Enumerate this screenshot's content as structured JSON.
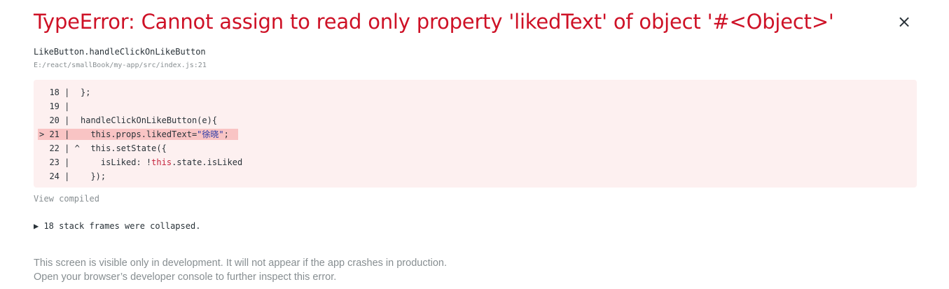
{
  "header": {
    "title": "TypeError: Cannot assign to read only property 'likedText' of object '#<Object>'",
    "close_label": "×"
  },
  "frame": {
    "function": "LikeButton.handleClickOnLikeButton",
    "file": "E:/react/smallBook/my-app/src/index.js:21"
  },
  "code": {
    "lines": [
      {
        "gutter": "  18 |",
        "src": "};"
      },
      {
        "gutter": "  19 |",
        "src": ""
      },
      {
        "gutter": "  20 |",
        "src": "handleClickOnLikeButton(e){"
      },
      {
        "gutter": "> 21 |",
        "pre": "  this.props.likedText=",
        "str": "\"徐晓\"",
        "post": ";"
      },
      {
        "gutter": "  22 | ^",
        "src": "  this.setState({"
      },
      {
        "gutter": "  23 |",
        "pre": "    isLiked: !",
        "kw": "this",
        "post": ".state.isLiked"
      },
      {
        "gutter": "  24 |",
        "src": "  });"
      }
    ]
  },
  "view_compiled": "View compiled",
  "collapsed": "▶ 18 stack frames were collapsed.",
  "footer": {
    "line1": "This screen is visible only in development. It will not appear if the app crashes in production.",
    "line2": "Open your browser’s developer console to further inspect this error."
  },
  "colors": {
    "error_red": "#ce1126",
    "code_bg": "#fdf0f0",
    "highlight_bg": "#f9c4c4",
    "muted": "#878e91"
  }
}
